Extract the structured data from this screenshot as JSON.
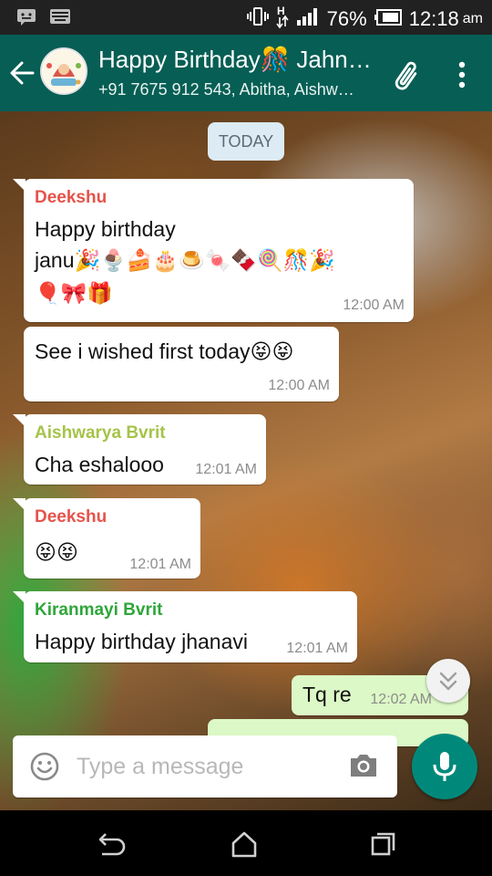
{
  "status_bar": {
    "battery_percent": "76%",
    "time": "12:18",
    "time_suffix": "am",
    "icons": [
      "bbm-icon",
      "keyboard-icon",
      "vibrate-icon",
      "data-transfer-icon",
      "signal-icon",
      "battery-icon"
    ]
  },
  "header": {
    "title": "Happy Birthday🎊 Jahn…",
    "subtitle": "+91 7675 912 543, Abitha, Aishw…",
    "icons": [
      "back-arrow-icon",
      "group-avatar",
      "paperclip-icon",
      "more-vert-icon"
    ]
  },
  "chat": {
    "date_label": "TODAY",
    "messages": [
      {
        "sender": "Deekshu",
        "sender_color": "#e5534b",
        "text_line1": "Happy birthday",
        "text_line2": "janu🎉🍨🍰🎂🍮🍬🍫🍭🎊🎉",
        "text_line3": "🎈🎀🎁",
        "time": "12:00 AM"
      },
      {
        "text": "See i wished first today😝😝",
        "time": "12:00 AM"
      },
      {
        "sender": "Aishwarya Bvrit",
        "sender_color": "#a6c34a",
        "text": "Cha eshalooo",
        "time": "12:01 AM"
      },
      {
        "sender": "Deekshu",
        "sender_color": "#e5534b",
        "text": "😝😝",
        "time": "12:01 AM"
      },
      {
        "sender": "Kiranmayi Bvrit",
        "sender_color": "#2fa63a",
        "text": "Happy birthday jhanavi",
        "time": "12:01 AM"
      },
      {
        "outgoing": true,
        "text": "Tq re",
        "time": "12:02 AM"
      }
    ]
  },
  "composer": {
    "placeholder": "Type a message",
    "value": ""
  },
  "colors": {
    "header": "#075e54",
    "outgoing_bubble": "#dcf8c6",
    "mic_button": "#00897b"
  }
}
